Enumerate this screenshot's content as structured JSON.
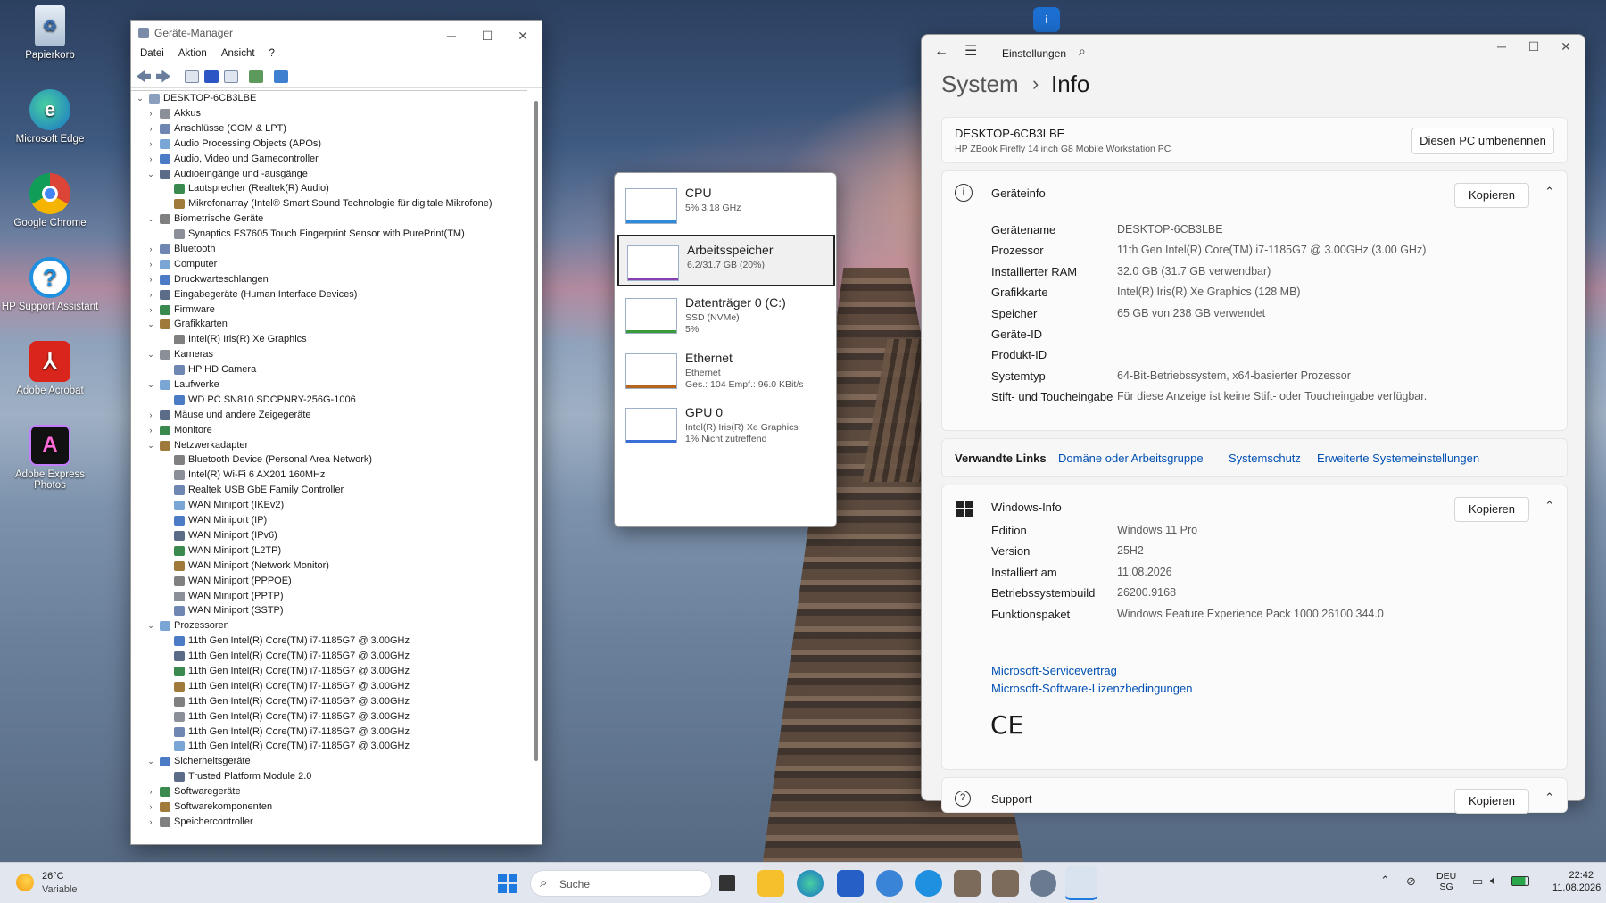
{
  "desktop": {
    "icons": [
      {
        "label": "Papierkorb"
      },
      {
        "label": "Microsoft Edge"
      },
      {
        "label": "Google Chrome"
      },
      {
        "label": "HP Support Assistant"
      },
      {
        "label": "Adobe Acrobat"
      },
      {
        "label": "Adobe Express Photos"
      }
    ]
  },
  "device_manager": {
    "title": "Geräte-Manager",
    "menu": [
      "Datei",
      "Aktion",
      "Ansicht",
      "?"
    ],
    "root": "DESKTOP-6CB3LBE",
    "tree": [
      {
        "level": 1,
        "expanded": false,
        "label": "Akkus"
      },
      {
        "level": 1,
        "expanded": false,
        "label": "Anschlüsse (COM & LPT)"
      },
      {
        "level": 1,
        "expanded": false,
        "label": "Audio Processing Objects (APOs)"
      },
      {
        "level": 1,
        "expanded": false,
        "label": "Audio, Video und Gamecontroller"
      },
      {
        "level": 1,
        "expanded": true,
        "label": "Audioeingänge und -ausgänge"
      },
      {
        "level": 2,
        "label": "Lautsprecher (Realtek(R) Audio)"
      },
      {
        "level": 2,
        "label": "Mikrofonarray (Intel® Smart Sound Technologie für digitale Mikrofone)"
      },
      {
        "level": 1,
        "expanded": true,
        "label": "Biometrische Geräte"
      },
      {
        "level": 2,
        "label": "Synaptics FS7605 Touch Fingerprint Sensor with PurePrint(TM)"
      },
      {
        "level": 1,
        "expanded": false,
        "label": "Bluetooth"
      },
      {
        "level": 1,
        "expanded": false,
        "label": "Computer"
      },
      {
        "level": 1,
        "expanded": false,
        "label": "Druckwarteschlangen"
      },
      {
        "level": 1,
        "expanded": false,
        "label": "Eingabegeräte (Human Interface Devices)"
      },
      {
        "level": 1,
        "expanded": false,
        "label": "Firmware"
      },
      {
        "level": 1,
        "expanded": true,
        "label": "Grafikkarten"
      },
      {
        "level": 2,
        "label": "Intel(R) Iris(R) Xe Graphics"
      },
      {
        "level": 1,
        "expanded": true,
        "label": "Kameras"
      },
      {
        "level": 2,
        "label": "HP HD Camera"
      },
      {
        "level": 1,
        "expanded": true,
        "label": "Laufwerke"
      },
      {
        "level": 2,
        "label": "WD PC SN810 SDCPNRY-256G-1006"
      },
      {
        "level": 1,
        "expanded": false,
        "label": "Mäuse und andere Zeigegeräte"
      },
      {
        "level": 1,
        "expanded": false,
        "label": "Monitore"
      },
      {
        "level": 1,
        "expanded": true,
        "label": "Netzwerkadapter"
      },
      {
        "level": 2,
        "label": "Bluetooth Device (Personal Area Network)"
      },
      {
        "level": 2,
        "label": "Intel(R) Wi-Fi 6 AX201 160MHz"
      },
      {
        "level": 2,
        "label": "Realtek USB GbE Family Controller"
      },
      {
        "level": 2,
        "label": "WAN Miniport (IKEv2)"
      },
      {
        "level": 2,
        "label": "WAN Miniport (IP)"
      },
      {
        "level": 2,
        "label": "WAN Miniport (IPv6)"
      },
      {
        "level": 2,
        "label": "WAN Miniport (L2TP)"
      },
      {
        "level": 2,
        "label": "WAN Miniport (Network Monitor)"
      },
      {
        "level": 2,
        "label": "WAN Miniport (PPPOE)"
      },
      {
        "level": 2,
        "label": "WAN Miniport (PPTP)"
      },
      {
        "level": 2,
        "label": "WAN Miniport (SSTP)"
      },
      {
        "level": 1,
        "expanded": true,
        "label": "Prozessoren"
      },
      {
        "level": 2,
        "label": "11th Gen Intel(R) Core(TM) i7-1185G7 @ 3.00GHz"
      },
      {
        "level": 2,
        "label": "11th Gen Intel(R) Core(TM) i7-1185G7 @ 3.00GHz"
      },
      {
        "level": 2,
        "label": "11th Gen Intel(R) Core(TM) i7-1185G7 @ 3.00GHz"
      },
      {
        "level": 2,
        "label": "11th Gen Intel(R) Core(TM) i7-1185G7 @ 3.00GHz"
      },
      {
        "level": 2,
        "label": "11th Gen Intel(R) Core(TM) i7-1185G7 @ 3.00GHz"
      },
      {
        "level": 2,
        "label": "11th Gen Intel(R) Core(TM) i7-1185G7 @ 3.00GHz"
      },
      {
        "level": 2,
        "label": "11th Gen Intel(R) Core(TM) i7-1185G7 @ 3.00GHz"
      },
      {
        "level": 2,
        "label": "11th Gen Intel(R) Core(TM) i7-1185G7 @ 3.00GHz"
      },
      {
        "level": 1,
        "expanded": true,
        "label": "Sicherheitsgeräte"
      },
      {
        "level": 2,
        "label": "Trusted Platform Module 2.0"
      },
      {
        "level": 1,
        "expanded": false,
        "label": "Softwaregeräte"
      },
      {
        "level": 1,
        "expanded": false,
        "label": "Softwarekomponenten"
      },
      {
        "level": 1,
        "expanded": false,
        "label": "Speichercontroller"
      }
    ]
  },
  "task_manager": {
    "items": [
      {
        "name": "CPU",
        "lines": [
          "5% 3.18 GHz"
        ],
        "selected": false
      },
      {
        "name": "Arbeitsspeicher",
        "lines": [
          "6.2/31.7 GB (20%)"
        ],
        "selected": true
      },
      {
        "name": "Datenträger 0 (C:)",
        "lines": [
          "SSD (NVMe)",
          "5%"
        ],
        "selected": false
      },
      {
        "name": "Ethernet",
        "lines": [
          "Ethernet",
          "Ges.: 104 Empf.: 96.0 KBit/s"
        ],
        "selected": false
      },
      {
        "name": "GPU 0",
        "lines": [
          "Intel(R) Iris(R) Xe Graphics",
          "1% Nicht zutreffend"
        ],
        "selected": false
      }
    ]
  },
  "settings": {
    "app_title": "Einstellungen",
    "breadcrumb_parent": "System",
    "breadcrumb_sep": "›",
    "page_title": "Info",
    "device_name": "DESKTOP-6CB3LBE",
    "device_model": "HP ZBook Firefly 14 inch G8 Mobile Workstation PC",
    "rename_button": "Diesen PC umbenennen",
    "device_info": {
      "heading": "Geräteinfo",
      "copy": "Kopieren",
      "rows": [
        {
          "label": "Gerätename",
          "value": "DESKTOP-6CB3LBE"
        },
        {
          "label": "Prozessor",
          "value": "11th Gen Intel(R) Core(TM) i7-1185G7 @ 3.00GHz (3.00 GHz)"
        },
        {
          "label": "Installierter RAM",
          "value": "32.0 GB (31.7 GB verwendbar)"
        },
        {
          "label": "Grafikkarte",
          "value": "Intel(R) Iris(R) Xe Graphics (128 MB)"
        },
        {
          "label": "Speicher",
          "value": "65 GB von 238 GB verwendet"
        },
        {
          "label": "Geräte-ID",
          "value": ""
        },
        {
          "label": "Produkt-ID",
          "value": ""
        },
        {
          "label": "Systemtyp",
          "value": "64-Bit-Betriebssystem, x64-basierter Prozessor"
        },
        {
          "label": "Stift- und Toucheingabe",
          "value": "Für diese Anzeige ist keine Stift- oder Toucheingabe verfügbar."
        }
      ]
    },
    "related": {
      "label": "Verwandte Links",
      "links": [
        "Domäne oder Arbeitsgruppe",
        "Systemschutz",
        "Erweiterte Systemeinstellungen"
      ]
    },
    "windows_info": {
      "heading": "Windows-Info",
      "copy": "Kopieren",
      "rows": [
        {
          "label": "Edition",
          "value": "Windows 11 Pro"
        },
        {
          "label": "Version",
          "value": "25H2"
        },
        {
          "label": "Installiert am",
          "value": "11.08.2026"
        },
        {
          "label": "Betriebssystembuild",
          "value": "26200.9168"
        },
        {
          "label": "Funktionspaket",
          "value": "Windows Feature Experience Pack 1000.26100.344.0"
        }
      ],
      "links": [
        "Microsoft-Servicevertrag",
        "Microsoft-Software-Lizenzbedingungen"
      ],
      "ce_mark": "CE"
    },
    "support": {
      "heading": "Support",
      "copy": "Kopieren"
    }
  },
  "taskbar": {
    "weather_temp": "26°C",
    "weather_desc": "Variable",
    "search_placeholder": "Suche",
    "lang_top": "DEU",
    "lang_bottom": "SG",
    "time": "22:42",
    "date": "11.08.2026"
  }
}
